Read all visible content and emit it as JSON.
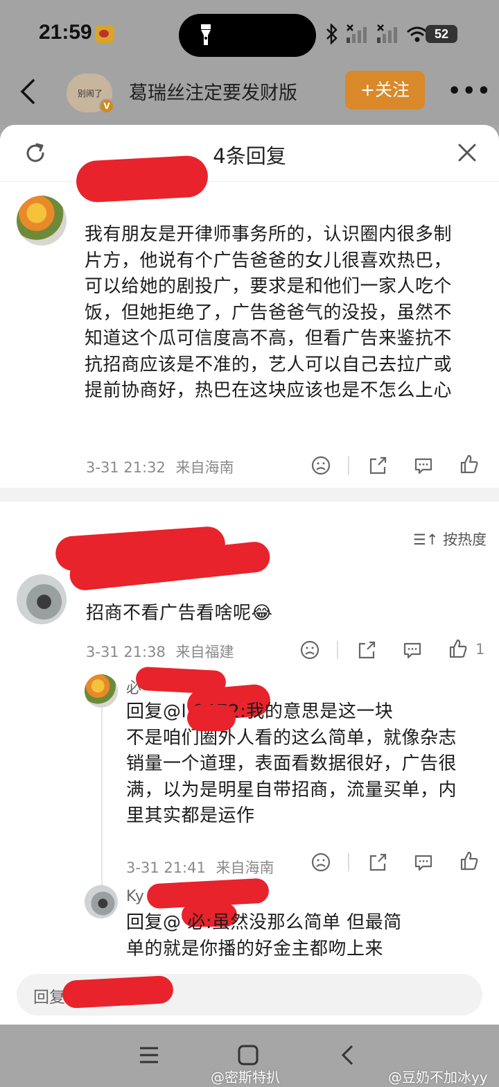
{
  "status_bar": {
    "time": "21:59",
    "battery": "52"
  },
  "header": {
    "avatar_text": "别闹了",
    "verified_mark": "V",
    "title": "葛瑞丝注定要发财版",
    "follow_label": "+关注",
    "more_label": "•••"
  },
  "sheet": {
    "title": "4条回复",
    "main_comment": {
      "text": "我有朋友是开律师事务所的，认识圈内很多制片方，他说有个广告爸爸的女儿很喜欢热巴，可以给她的剧投广，要求是和他们一家人吃个饭，但她拒绝了，广告爸爸气的没投，虽然不知道这个瓜可信度高不高，但看广告来鉴抗不抗招商应该是不准的，艺人可以自己去拉广或提前协商好，热巴在这块应该也是不怎么上心",
      "lines": [
        "我有朋友是开律师事务所的，认识圈内很多制",
        "片方，他说有个广告爸爸的女儿很喜欢热巴，",
        "可以给她的剧投广，要求是和他们一家人吃个",
        "饭，但她拒绝了，广告爸爸气的没投，虽然不",
        "知道这个瓜可信度高不高，但看广告来鉴抗不",
        "抗招商应该是不准的，艺人可以自己去拉广或",
        "提前协商好，热巴在这块应该也是不怎么上心"
      ],
      "time": "3-31 21:32",
      "location": "来自海南"
    },
    "sort_label": "按热度",
    "replies": [
      {
        "text": "招商不看广告看啥呢😂",
        "time": "3-31 21:38",
        "location": "来自福建",
        "likes": "1"
      },
      {
        "author_partial": "必",
        "lines": [
          "回复@l    0472:我的意思是这一块",
          "不是咱们圈外人看的这么简单，就像杂志",
          "销量一个道理，表面看数据很好，广告很",
          "满，以为是明星自带招商，流量买单，内",
          "里其实都是运作"
        ],
        "time": "3-31 21:41",
        "location": "来自海南"
      },
      {
        "author_partial": "Ky",
        "lines": [
          "回复@       必:虽然没那么简单 但最简",
          "单的就是你播的好金主都吻上来"
        ]
      }
    ],
    "reply_input_placeholder": "回复"
  },
  "watermarks": [
    "@密斯特扒",
    "@豆奶不加冰yy"
  ],
  "colors": {
    "accent": "#d9892a",
    "redaction": "#e8232b",
    "sheet_bg": "#ffffff",
    "dim_bg": "#a3a3a3"
  }
}
